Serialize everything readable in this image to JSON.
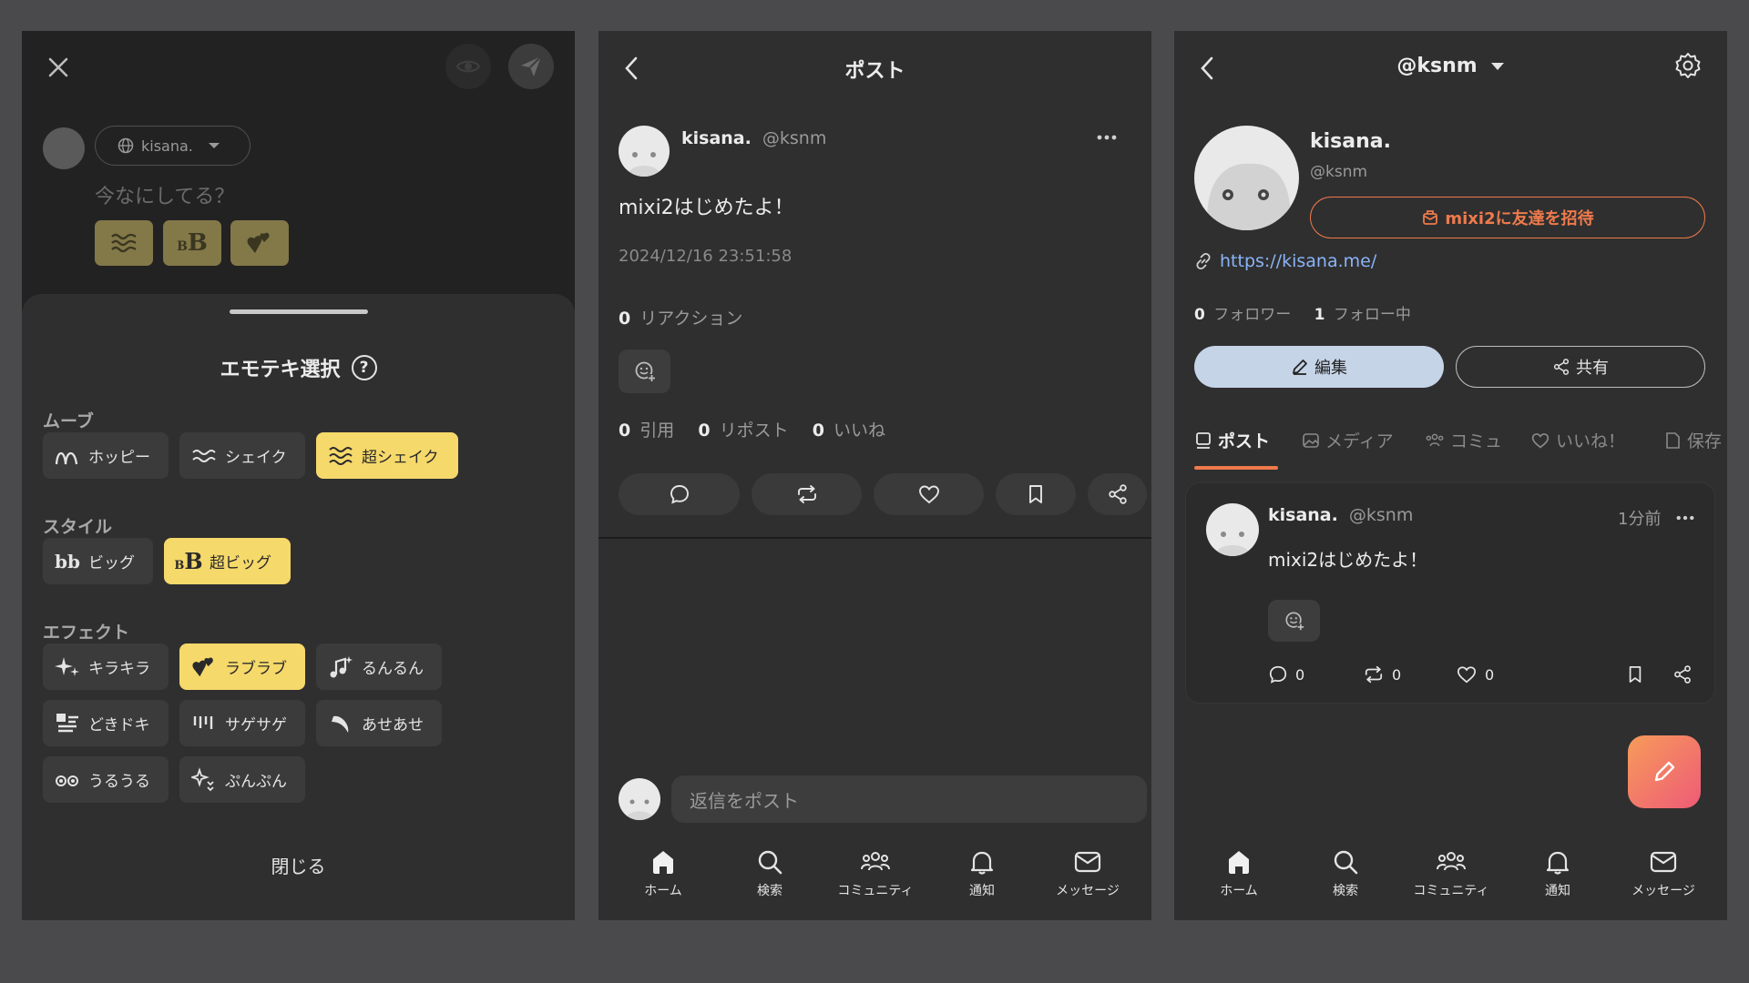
{
  "composer": {
    "account_name": "kisana.",
    "placeholder": "今なにしてる？",
    "sheet_title": "エモテキ選択",
    "sections": {
      "move": "ムーブ",
      "style": "スタイル",
      "effect": "エフェクト"
    },
    "move_chips": [
      "ホッピー",
      "シェイク",
      "超シェイク"
    ],
    "style_chips": [
      "ビッグ",
      "超ビッグ"
    ],
    "effect_chips": [
      "キラキラ",
      "ラブラブ",
      "るんるん",
      "どきドキ",
      "サゲサゲ",
      "あせあせ",
      "うるうる",
      "ぷんぷん"
    ],
    "close_label": "閉じる",
    "colors": {
      "selected": "#f6d96b",
      "chip": "#3b3b3b"
    }
  },
  "post_detail": {
    "title": "ポスト",
    "author_name": "kisana.",
    "author_handle": "@ksnm",
    "text": "mixi2はじめたよ！",
    "timestamp": "2024/12/16 23:51:58",
    "reactions_count": "0",
    "reactions_label": "リアクション",
    "quote_count": "0",
    "quote_label": "引用",
    "repost_count": "0",
    "repost_label": "リポスト",
    "like_count": "0",
    "like_label": "いいね",
    "reply_placeholder": "返信をポスト"
  },
  "nav": {
    "home": "ホーム",
    "search": "検索",
    "community": "コミュニティ",
    "notify": "通知",
    "message": "メッセージ"
  },
  "profile": {
    "header_handle": "@ksnm",
    "name": "kisana.",
    "handle": "@ksnm",
    "invite_label": "mixi2に友達を招待",
    "link": "https://kisana.me/",
    "followers_count": "0",
    "followers_label": "フォロワー",
    "following_count": "1",
    "following_label": "フォロー中",
    "edit_label": "編集",
    "share_label": "共有",
    "tabs": [
      "ポスト",
      "メディア",
      "コミュ",
      "いいね！",
      "保存"
    ],
    "post": {
      "author_name": "kisana.",
      "author_handle": "@ksnm",
      "time": "1分前",
      "text": "mixi2はじめたよ！",
      "reply_count": "0",
      "repost_count": "0",
      "like_count": "0"
    },
    "colors": {
      "accent": "#ef7a4c",
      "link": "#8ab4f8",
      "edit_bg": "#c6d4e8"
    }
  }
}
